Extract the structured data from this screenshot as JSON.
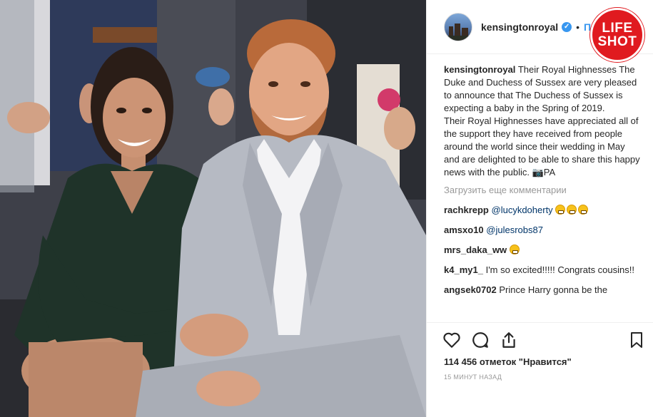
{
  "post": {
    "username": "kensingtonroyal",
    "verified_badge": "✓",
    "separator": "•",
    "follow_label": "По"
  },
  "watermark": {
    "line1": "LIFE",
    "line2": "SHOT",
    "color": "#e01a1f"
  },
  "caption": {
    "username": "kensingtonroyal",
    "paragraph1": "Their Royal Highnesses The Duke and Duchess of Sussex are very pleased to announce that The Duchess of Sussex is expecting a baby in the Spring of 2019.",
    "paragraph2": "Their Royal Highnesses have appreciated all of the support they have received from people around the world since their wedding in May and are delighted to be able to share this happy news with the public. 📷PA"
  },
  "load_more_label": "Загрузить еще комментарии",
  "comments": [
    {
      "username": "rachkrepp",
      "text": "@lucykdoherty",
      "emoji_count": 3
    },
    {
      "username": "amsxo10",
      "text": "@julesrobs87",
      "emoji_count": 0
    },
    {
      "username": "mrs_daka_ww",
      "text": "",
      "emoji_count": 1
    },
    {
      "username": "k4_my1_",
      "text": "I'm so excited!!!!! Congrats cousins!!",
      "emoji_count": 0
    },
    {
      "username": "angsek0702",
      "text": "Prince Harry gonna be the",
      "emoji_count": 0
    }
  ],
  "likes_label": "114 456 отметок \"Нравится\"",
  "timestamp": "15 МИНУТ НАЗАД",
  "icons": [
    "heart-icon",
    "comment-icon",
    "share-icon",
    "bookmark-icon"
  ],
  "colors": {
    "link": "#3897f0",
    "mention": "#003569",
    "muted": "#999999",
    "text": "#262626"
  }
}
